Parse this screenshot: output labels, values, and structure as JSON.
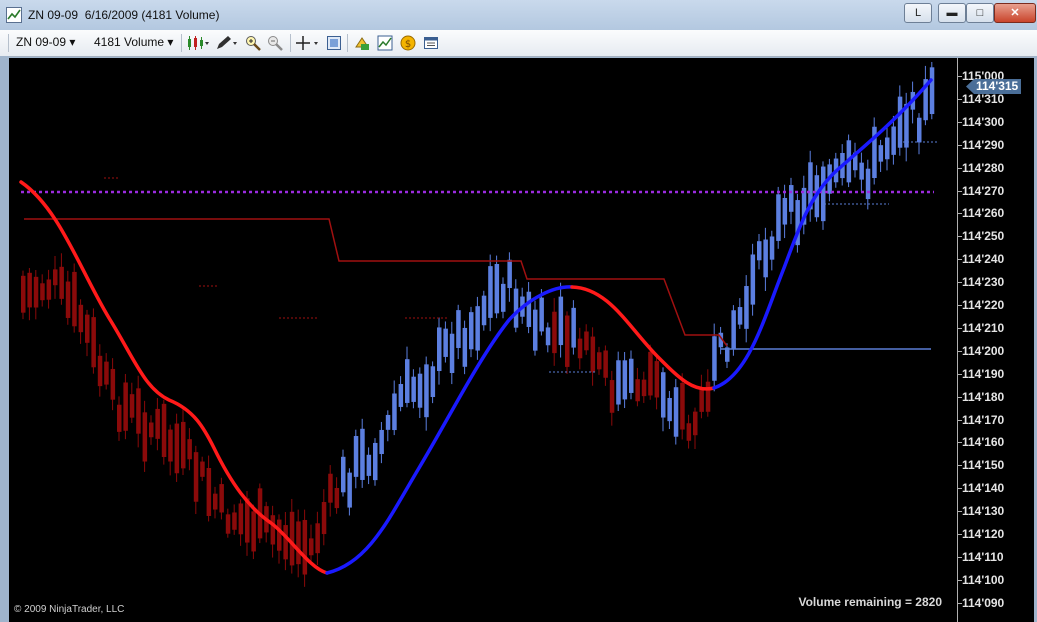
{
  "window": {
    "title": "ZN 09-09  6/16/2009 (4181 Volume)",
    "buttons": {
      "link": "L",
      "minimize": "▬",
      "maximize": "□",
      "close": "✕"
    }
  },
  "toolbar": {
    "instrument": "ZN 09-09",
    "period": "4181 Volume",
    "icons": [
      "bars-type-icon",
      "draw-pen-icon",
      "zoom-in-icon",
      "zoom-out-icon",
      "crosshair-icon",
      "properties-icon",
      "data-box-icon",
      "indicators-icon",
      "strategies-icon",
      "order-icon"
    ]
  },
  "chart": {
    "price_axis_labels": [
      "115'000",
      "114'310",
      "114'300",
      "114'290",
      "114'280",
      "114'270",
      "114'260",
      "114'250",
      "114'240",
      "114'230",
      "114'220",
      "114'210",
      "114'200",
      "114'190",
      "114'180",
      "114'170",
      "114'160",
      "114'150",
      "114'140",
      "114'130",
      "114'120",
      "114'110",
      "114'100",
      "114'090"
    ],
    "last_price": "114'315",
    "copyright": "© 2009 NinjaTrader, LLC",
    "volume_remaining": "Volume remaining = 2820",
    "colors": {
      "bear": "#8b0a0a",
      "bull": "#5c7fe0",
      "ma_down": "#ff1a1a",
      "ma_up": "#1a1aff",
      "level": "#9b2be0",
      "stop_red": "#a01010",
      "stop_blue": "#5a7ed6"
    }
  }
}
